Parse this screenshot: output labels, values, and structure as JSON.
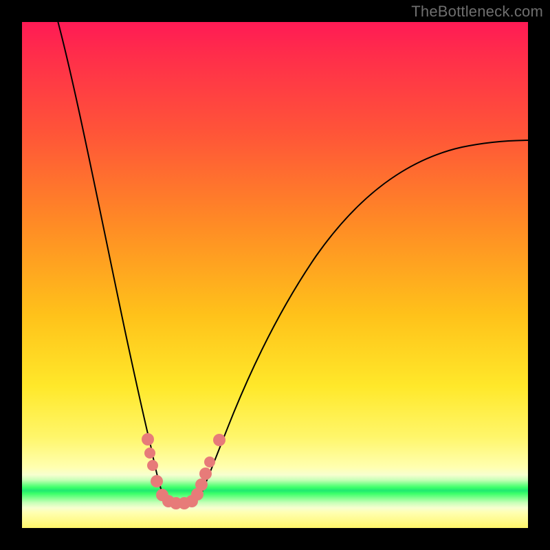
{
  "watermark": "TheBottleneck.com",
  "colors": {
    "frame": "#000000",
    "curve": "#000000",
    "dot": "#e77b79",
    "gradient_top": "#ff1a55",
    "gradient_mid": "#ffe82a",
    "gradient_green": "#20e870"
  },
  "chart_data": {
    "type": "line",
    "title": "",
    "xlabel": "",
    "ylabel": "",
    "x": [
      0.0,
      0.02,
      0.04,
      0.06,
      0.08,
      0.1,
      0.12,
      0.14,
      0.16,
      0.18,
      0.2,
      0.22,
      0.24,
      0.26,
      0.27,
      0.28,
      0.3,
      0.32,
      0.34,
      0.36,
      0.38,
      0.4,
      0.45,
      0.5,
      0.55,
      0.6,
      0.65,
      0.7,
      0.75,
      0.8,
      0.85,
      0.9,
      0.95,
      1.0
    ],
    "values": [
      1.0,
      0.94,
      0.87,
      0.8,
      0.73,
      0.66,
      0.59,
      0.52,
      0.45,
      0.38,
      0.3,
      0.22,
      0.13,
      0.04,
      0.0,
      0.0,
      0.0,
      0.02,
      0.08,
      0.15,
      0.22,
      0.29,
      0.41,
      0.5,
      0.57,
      0.62,
      0.66,
      0.69,
      0.71,
      0.73,
      0.74,
      0.75,
      0.76,
      0.76
    ],
    "xlim": [
      0,
      1
    ],
    "ylim": [
      0,
      1
    ],
    "annotations": {
      "dots_cluster_x_range": [
        0.24,
        0.35
      ],
      "dots_cluster_y_approx": 0.0
    },
    "notes": "Axes unlabeled in source image; x and y normalized 0..1. Curve is a steep V with minimum near x≈0.27–0.30, right branch asymptoting near y≈0.76. Background color encodes y-value (red=high, green=low). Pink dots mark samples clustered around the valley."
  }
}
